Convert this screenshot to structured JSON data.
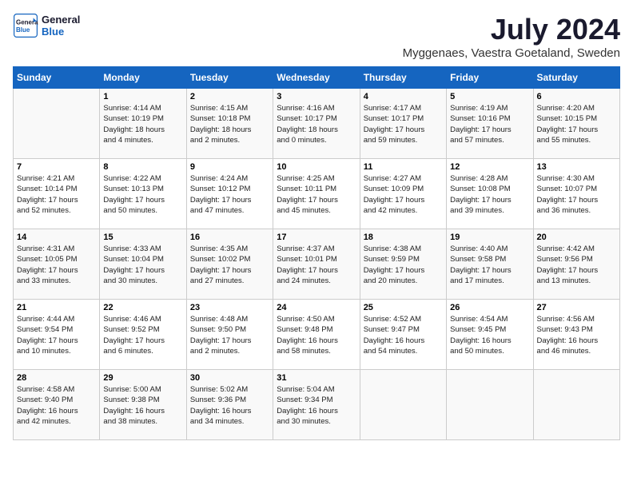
{
  "logo": {
    "line1": "General",
    "line2": "Blue"
  },
  "title": "July 2024",
  "location": "Myggenaes, Vaestra Goetaland, Sweden",
  "headers": [
    "Sunday",
    "Monday",
    "Tuesday",
    "Wednesday",
    "Thursday",
    "Friday",
    "Saturday"
  ],
  "weeks": [
    [
      {
        "day": "",
        "info": ""
      },
      {
        "day": "1",
        "info": "Sunrise: 4:14 AM\nSunset: 10:19 PM\nDaylight: 18 hours\nand 4 minutes."
      },
      {
        "day": "2",
        "info": "Sunrise: 4:15 AM\nSunset: 10:18 PM\nDaylight: 18 hours\nand 2 minutes."
      },
      {
        "day": "3",
        "info": "Sunrise: 4:16 AM\nSunset: 10:17 PM\nDaylight: 18 hours\nand 0 minutes."
      },
      {
        "day": "4",
        "info": "Sunrise: 4:17 AM\nSunset: 10:17 PM\nDaylight: 17 hours\nand 59 minutes."
      },
      {
        "day": "5",
        "info": "Sunrise: 4:19 AM\nSunset: 10:16 PM\nDaylight: 17 hours\nand 57 minutes."
      },
      {
        "day": "6",
        "info": "Sunrise: 4:20 AM\nSunset: 10:15 PM\nDaylight: 17 hours\nand 55 minutes."
      }
    ],
    [
      {
        "day": "7",
        "info": "Sunrise: 4:21 AM\nSunset: 10:14 PM\nDaylight: 17 hours\nand 52 minutes."
      },
      {
        "day": "8",
        "info": "Sunrise: 4:22 AM\nSunset: 10:13 PM\nDaylight: 17 hours\nand 50 minutes."
      },
      {
        "day": "9",
        "info": "Sunrise: 4:24 AM\nSunset: 10:12 PM\nDaylight: 17 hours\nand 47 minutes."
      },
      {
        "day": "10",
        "info": "Sunrise: 4:25 AM\nSunset: 10:11 PM\nDaylight: 17 hours\nand 45 minutes."
      },
      {
        "day": "11",
        "info": "Sunrise: 4:27 AM\nSunset: 10:09 PM\nDaylight: 17 hours\nand 42 minutes."
      },
      {
        "day": "12",
        "info": "Sunrise: 4:28 AM\nSunset: 10:08 PM\nDaylight: 17 hours\nand 39 minutes."
      },
      {
        "day": "13",
        "info": "Sunrise: 4:30 AM\nSunset: 10:07 PM\nDaylight: 17 hours\nand 36 minutes."
      }
    ],
    [
      {
        "day": "14",
        "info": "Sunrise: 4:31 AM\nSunset: 10:05 PM\nDaylight: 17 hours\nand 33 minutes."
      },
      {
        "day": "15",
        "info": "Sunrise: 4:33 AM\nSunset: 10:04 PM\nDaylight: 17 hours\nand 30 minutes."
      },
      {
        "day": "16",
        "info": "Sunrise: 4:35 AM\nSunset: 10:02 PM\nDaylight: 17 hours\nand 27 minutes."
      },
      {
        "day": "17",
        "info": "Sunrise: 4:37 AM\nSunset: 10:01 PM\nDaylight: 17 hours\nand 24 minutes."
      },
      {
        "day": "18",
        "info": "Sunrise: 4:38 AM\nSunset: 9:59 PM\nDaylight: 17 hours\nand 20 minutes."
      },
      {
        "day": "19",
        "info": "Sunrise: 4:40 AM\nSunset: 9:58 PM\nDaylight: 17 hours\nand 17 minutes."
      },
      {
        "day": "20",
        "info": "Sunrise: 4:42 AM\nSunset: 9:56 PM\nDaylight: 17 hours\nand 13 minutes."
      }
    ],
    [
      {
        "day": "21",
        "info": "Sunrise: 4:44 AM\nSunset: 9:54 PM\nDaylight: 17 hours\nand 10 minutes."
      },
      {
        "day": "22",
        "info": "Sunrise: 4:46 AM\nSunset: 9:52 PM\nDaylight: 17 hours\nand 6 minutes."
      },
      {
        "day": "23",
        "info": "Sunrise: 4:48 AM\nSunset: 9:50 PM\nDaylight: 17 hours\nand 2 minutes."
      },
      {
        "day": "24",
        "info": "Sunrise: 4:50 AM\nSunset: 9:48 PM\nDaylight: 16 hours\nand 58 minutes."
      },
      {
        "day": "25",
        "info": "Sunrise: 4:52 AM\nSunset: 9:47 PM\nDaylight: 16 hours\nand 54 minutes."
      },
      {
        "day": "26",
        "info": "Sunrise: 4:54 AM\nSunset: 9:45 PM\nDaylight: 16 hours\nand 50 minutes."
      },
      {
        "day": "27",
        "info": "Sunrise: 4:56 AM\nSunset: 9:43 PM\nDaylight: 16 hours\nand 46 minutes."
      }
    ],
    [
      {
        "day": "28",
        "info": "Sunrise: 4:58 AM\nSunset: 9:40 PM\nDaylight: 16 hours\nand 42 minutes."
      },
      {
        "day": "29",
        "info": "Sunrise: 5:00 AM\nSunset: 9:38 PM\nDaylight: 16 hours\nand 38 minutes."
      },
      {
        "day": "30",
        "info": "Sunrise: 5:02 AM\nSunset: 9:36 PM\nDaylight: 16 hours\nand 34 minutes."
      },
      {
        "day": "31",
        "info": "Sunrise: 5:04 AM\nSunset: 9:34 PM\nDaylight: 16 hours\nand 30 minutes."
      },
      {
        "day": "",
        "info": ""
      },
      {
        "day": "",
        "info": ""
      },
      {
        "day": "",
        "info": ""
      }
    ]
  ]
}
